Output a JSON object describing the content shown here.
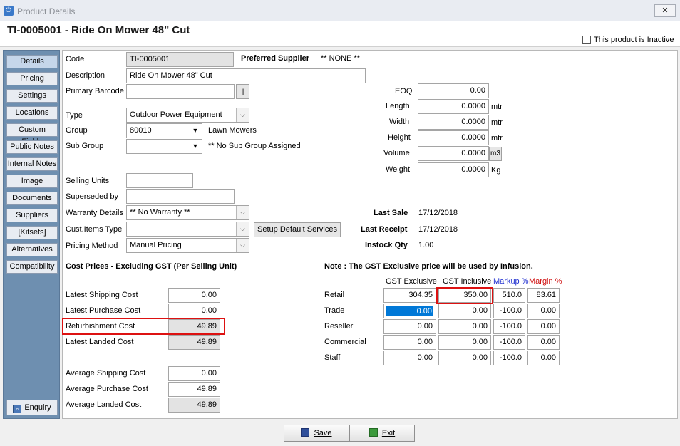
{
  "window": {
    "title": "Product Details",
    "close_label": "✕"
  },
  "header": {
    "product_title": "TI-0005001 - Ride On Mower 48\" Cut",
    "inactive_label": "This product is Inactive"
  },
  "sidebar": {
    "items": [
      "Details",
      "Pricing",
      "Settings",
      "Locations",
      "Custom Fields",
      "Public Notes",
      "Internal Notes",
      "Image",
      "Documents",
      "Suppliers",
      "[Kitsets]",
      "Alternatives",
      "Compatibility"
    ],
    "enquiry_label": "Enquiry"
  },
  "details": {
    "code_label": "Code",
    "code_value": "TI-0005001",
    "preferred_supplier_label": "Preferred Supplier",
    "preferred_supplier_value": "** NONE **",
    "description_label": "Description",
    "description_value": "Ride On Mower 48\" Cut",
    "primary_barcode_label": "Primary Barcode",
    "primary_barcode_value": "",
    "type_label": "Type",
    "type_value": "Outdoor Power Equipment",
    "group_label": "Group",
    "group_value": "80010",
    "group_name": "Lawn Mowers",
    "subgroup_label": "Sub Group",
    "subgroup_value": "",
    "subgroup_name": "** No Sub Group Assigned",
    "selling_units_label": "Selling Units",
    "selling_units_value": "",
    "superseded_label": "Superseded by",
    "superseded_value": "",
    "warranty_label": "Warranty Details",
    "warranty_value": "** No Warranty **",
    "cust_items_label": "Cust.Items Type",
    "cust_items_value": "",
    "setup_services_label": "Setup Default Services",
    "pricing_method_label": "Pricing Method",
    "pricing_method_value": "Manual Pricing"
  },
  "dimensions": {
    "eoq_label": "EOQ",
    "eoq_value": "0.00",
    "length_label": "Length",
    "length_value": "0.0000",
    "length_unit": "mtr",
    "width_label": "Width",
    "width_value": "0.0000",
    "width_unit": "mtr",
    "height_label": "Height",
    "height_value": "0.0000",
    "height_unit": "mtr",
    "volume_label": "Volume",
    "volume_value": "0.0000",
    "volume_unit": "m3",
    "weight_label": "Weight",
    "weight_value": "0.0000",
    "weight_unit": "Kg"
  },
  "sales": {
    "last_sale_label": "Last Sale",
    "last_sale_value": "17/12/2018",
    "last_receipt_label": "Last Receipt",
    "last_receipt_value": "17/12/2018",
    "instock_label": "Instock Qty",
    "instock_value": "1.00"
  },
  "costs": {
    "heading": "Cost Prices - Excluding GST (Per Selling Unit)",
    "latest_shipping_label": "Latest Shipping Cost",
    "latest_shipping_value": "0.00",
    "latest_purchase_label": "Latest Purchase Cost",
    "latest_purchase_value": "0.00",
    "refurbishment_label": "Refurbishment Cost",
    "refurbishment_value": "49.89",
    "latest_landed_label": "Latest Landed Cost",
    "latest_landed_value": "49.89",
    "avg_shipping_label": "Average Shipping Cost",
    "avg_shipping_value": "0.00",
    "avg_purchase_label": "Average Purchase Cost",
    "avg_purchase_value": "49.89",
    "avg_landed_label": "Average Landed Cost",
    "avg_landed_value": "49.89"
  },
  "prices": {
    "note": "Note : The GST Exclusive price will be used by Infusion.",
    "col_gst_excl": "GST Exclusive",
    "col_gst_incl": "GST Inclusive",
    "col_markup": "Markup %",
    "col_margin": "Margin %",
    "markup_color": "#1f2fd0",
    "margin_color": "#d01010",
    "rows": [
      {
        "label": "Retail",
        "excl": "304.35",
        "incl": "350.00",
        "markup": "510.0",
        "margin": "83.61"
      },
      {
        "label": "Trade",
        "excl": "0.00",
        "incl": "0.00",
        "markup": "-100.0",
        "margin": "0.00"
      },
      {
        "label": "Reseller",
        "excl": "0.00",
        "incl": "0.00",
        "markup": "-100.0",
        "margin": "0.00"
      },
      {
        "label": "Commercial",
        "excl": "0.00",
        "incl": "0.00",
        "markup": "-100.0",
        "margin": "0.00"
      },
      {
        "label": "Staff",
        "excl": "0.00",
        "incl": "0.00",
        "markup": "-100.0",
        "margin": "0.00"
      }
    ]
  },
  "footer": {
    "save_label": "Save",
    "exit_label": "Exit"
  }
}
